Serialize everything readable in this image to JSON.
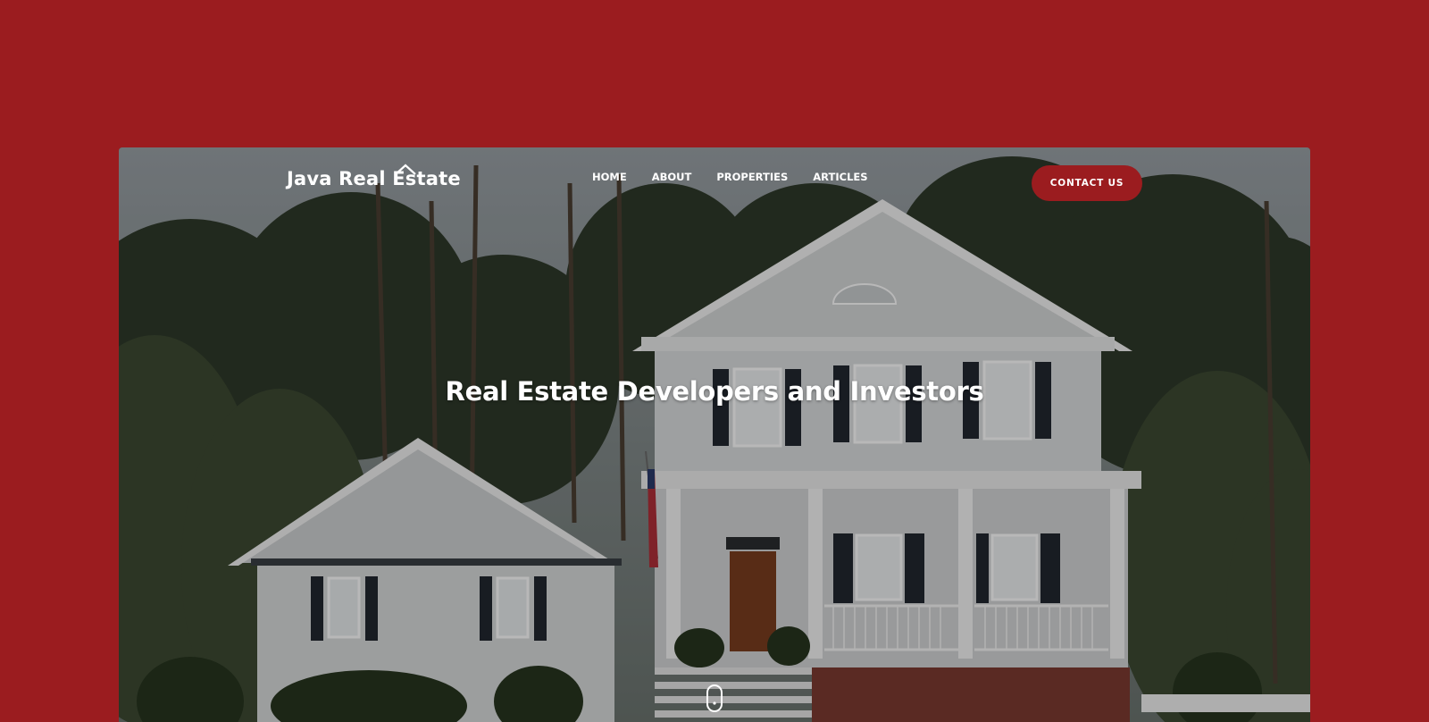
{
  "site": {
    "logo_text": "Java Real Estate"
  },
  "nav": {
    "items": [
      {
        "label": "HOME"
      },
      {
        "label": "ABOUT"
      },
      {
        "label": "PROPERTIES"
      },
      {
        "label": "ARTICLES"
      }
    ]
  },
  "cta": {
    "contact_label": "CONTACT US"
  },
  "hero": {
    "headline": "Real Estate Developers and Investors",
    "image": "house-with-porch-photo"
  },
  "colors": {
    "brand": "#9b1c1f",
    "text_on_dark": "#ffffff"
  },
  "icons": {
    "logo": "house-roof-icon",
    "scroll": "mouse-scroll-icon"
  }
}
